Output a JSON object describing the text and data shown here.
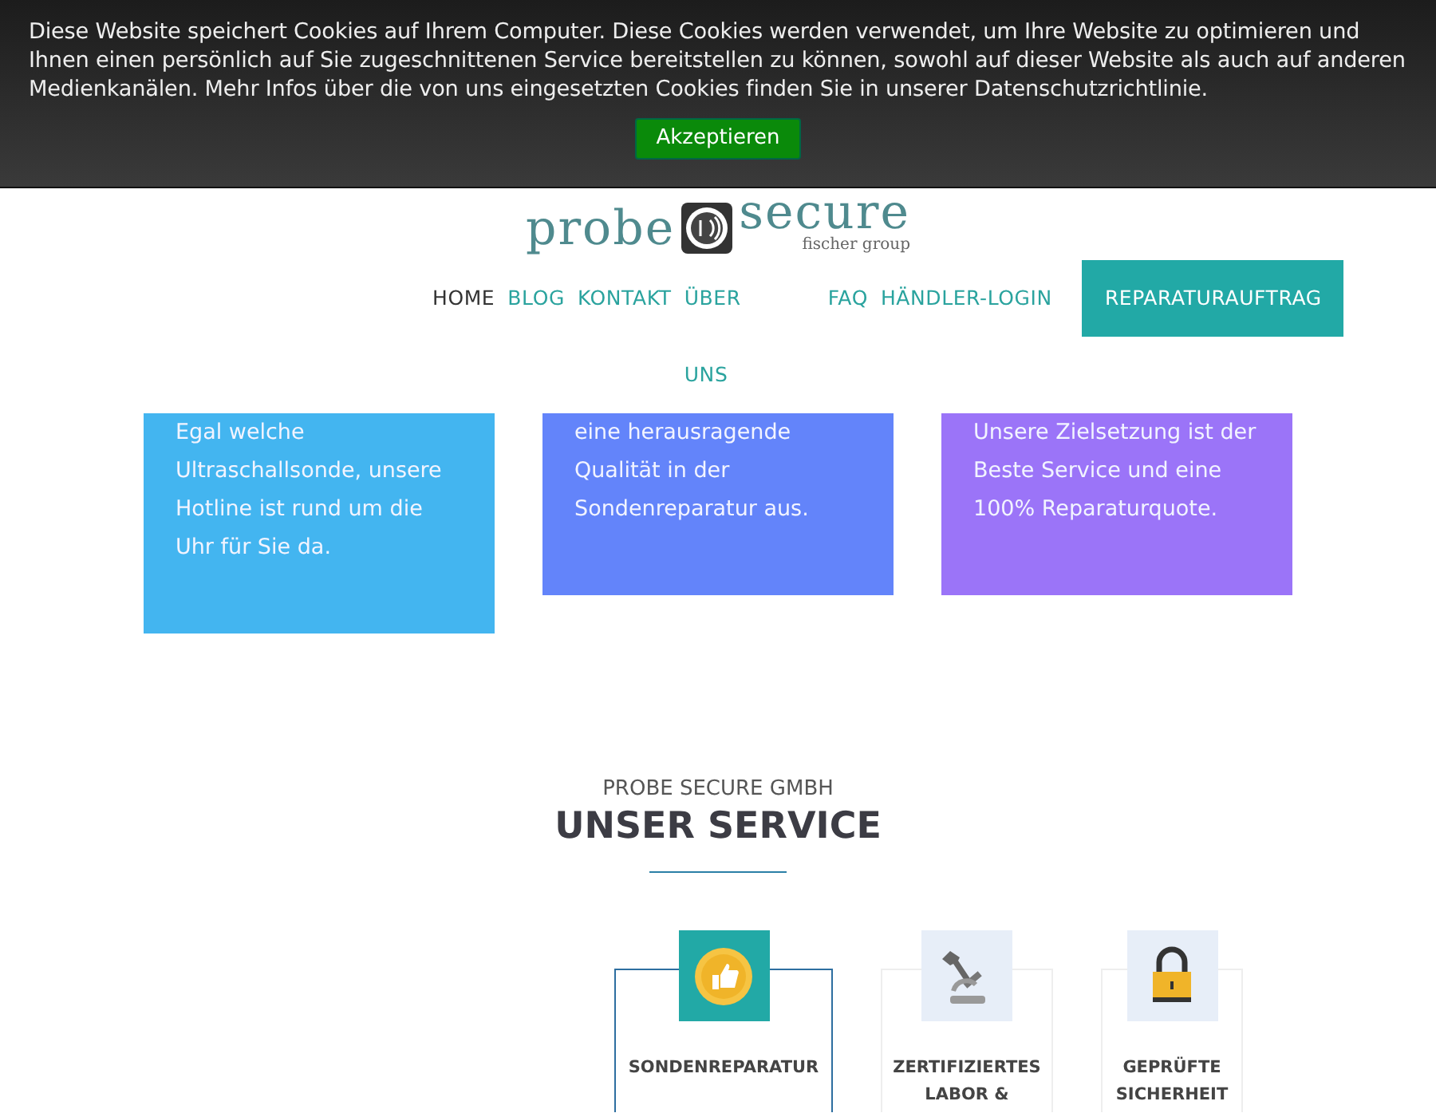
{
  "cookie_banner": {
    "message": "Diese Website speichert Cookies auf Ihrem Computer. Diese Cookies werden verwendet, um Ihre Website zu optimieren und Ihnen einen persönlich auf Sie zugeschnittenen Service bereitstellen zu können, sowohl auf dieser Website als auch auf anderen Medienkanälen. Mehr Infos über die von uns eingesetzten Cookies finden Sie in unserer Datenschutzrichtlinie.",
    "button": "Akzeptieren"
  },
  "logo": {
    "word_1": "probe",
    "word_2": "secure",
    "tagline": "fischer group"
  },
  "nav": [
    {
      "label": "HOME",
      "selected": true,
      "kind": "link"
    },
    {
      "label": "BLOG",
      "selected": false,
      "kind": "link"
    },
    {
      "label": "KONTAKT",
      "selected": false,
      "kind": "link"
    },
    {
      "label": "ÜBER UNS",
      "selected": false,
      "kind": "link"
    },
    {
      "label": "FAQ",
      "selected": false,
      "kind": "link"
    },
    {
      "label": "HÄNDLER-LOGIN",
      "selected": false,
      "kind": "link"
    },
    {
      "label": "REPARATURAUFTRAG",
      "selected": false,
      "kind": "button"
    }
  ],
  "feature_cards": [
    {
      "text": "Egal welche Ultraschallsonde, unsere Hotline ist rund um die Uhr für Sie da.",
      "color": "#43b5f0"
    },
    {
      "text": "eine herausragende Qualität in der Sondenreparatur aus.",
      "color": "#6384fa"
    },
    {
      "text": "Unsere Zielsetzung ist der Beste Service und eine 100% Reparaturquote.",
      "color": "#9b74f8"
    }
  ],
  "service": {
    "kicker": "PROBE SECURE GMBH",
    "title": "UNSER SERVICE",
    "items": [
      {
        "label": "SONDENREPARATUR",
        "selected": true
      },
      {
        "label": "ZERTIFIZIERTES LABOR &",
        "selected": false
      },
      {
        "label": "GEPRÜFTE SICHERHEIT",
        "selected": false
      }
    ]
  }
}
